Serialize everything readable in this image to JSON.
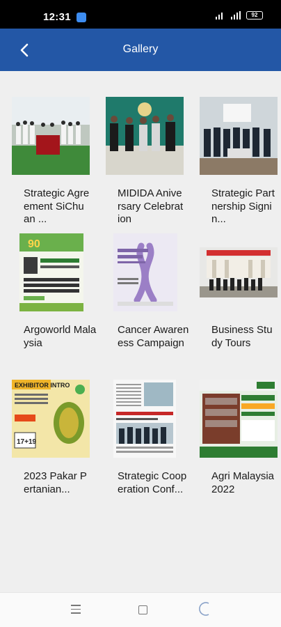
{
  "status_bar": {
    "time": "12:31",
    "battery": "92"
  },
  "app_bar": {
    "title": "Gallery",
    "back_icon": "chevron-left-icon"
  },
  "gallery": [
    {
      "label": "Strategic Agreement SiChuan ..."
    },
    {
      "label": "MIDIDA Aniversary Celebration"
    },
    {
      "label": "Strategic Partnership Signin..."
    },
    {
      "label": "Argoworld Malaysia"
    },
    {
      "label": "Cancer Awareness Campaign"
    },
    {
      "label": "Business Study Tours"
    },
    {
      "label": "2023 Pakar Pertanian..."
    },
    {
      "label": "Strategic Cooperation Conf..."
    },
    {
      "label": "Agri Malaysia 2022"
    }
  ],
  "colors": {
    "app_bar": "#2357a6",
    "background": "#efefef"
  },
  "nav_bar": {
    "icons": [
      "menu-icon",
      "home-icon",
      "back-icon"
    ]
  }
}
